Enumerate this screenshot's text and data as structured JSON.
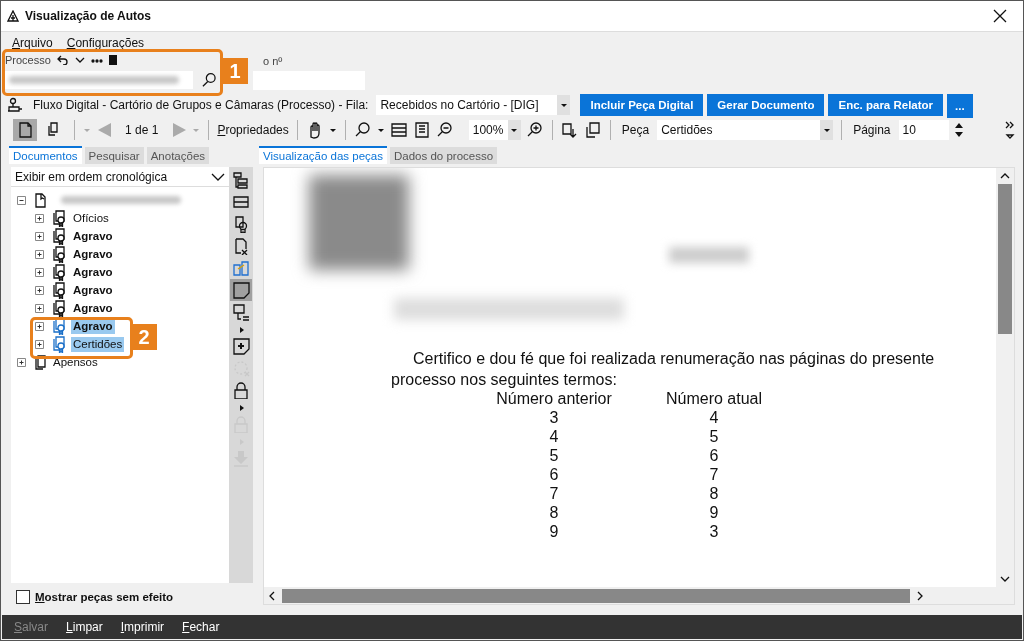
{
  "window": {
    "title": "Visualização de Autos"
  },
  "menu": [
    {
      "label": "Arquivo"
    },
    {
      "label": "Configurações"
    }
  ],
  "process": {
    "label": "Processo",
    "number_label": "o nº"
  },
  "flow": {
    "text": "Fluxo Digital - Cartório de Grupos e Câmaras (Processo) - Fila:",
    "queue": "Recebidos no Cartório - [DIG]",
    "buttons": [
      "Incluir Peça Digital",
      "Gerar Documento",
      "Enc. para Relator",
      "..."
    ]
  },
  "toolbar": {
    "page_indicator": "1 de 1",
    "properties": "Propriedades",
    "zoom": "100%",
    "piece_label": "Peça",
    "piece": "Certidões",
    "page_label": "Página",
    "page": "10"
  },
  "left_tabs": [
    {
      "label": "Documentos",
      "selected": true
    },
    {
      "label": "Pesquisar",
      "selected": false
    },
    {
      "label": "Anotações",
      "selected": false
    }
  ],
  "order_select": "Exibir em ordem cronológica",
  "tree": [
    {
      "kind": "volume",
      "expanded": true,
      "children": [
        {
          "label": "Ofícios",
          "bold": false,
          "selected": false,
          "expanded": false
        },
        {
          "label": "Agravo",
          "bold": true,
          "selected": false,
          "expanded": false
        },
        {
          "label": "Agravo",
          "bold": true,
          "selected": false,
          "expanded": false
        },
        {
          "label": "Agravo",
          "bold": true,
          "selected": false,
          "expanded": false
        },
        {
          "label": "Agravo",
          "bold": true,
          "selected": false,
          "expanded": false
        },
        {
          "label": "Agravo",
          "bold": true,
          "selected": false,
          "expanded": false
        },
        {
          "label": "Agravo",
          "bold": true,
          "selected": true,
          "expanded": false
        },
        {
          "label": "Certidões",
          "bold": false,
          "selected": true,
          "expanded": false
        }
      ]
    },
    {
      "kind": "apensos",
      "label": "Apensos",
      "expanded": false
    }
  ],
  "side_tools": [
    {
      "kind": "tree",
      "pressed": false,
      "disabled": false
    },
    {
      "kind": "split",
      "pressed": false,
      "disabled": false
    },
    {
      "kind": "cert",
      "pressed": false,
      "disabled": false
    },
    {
      "kind": "remove",
      "pressed": false,
      "disabled": false
    },
    {
      "kind": "compare",
      "pressed": false,
      "disabled": false
    },
    {
      "kind": "note",
      "pressed": true,
      "disabled": false
    },
    {
      "kind": "notelist",
      "pressed": false,
      "disabled": false
    },
    {
      "kind": "caret",
      "pressed": false,
      "disabled": false
    },
    {
      "kind": "noteadd",
      "pressed": false,
      "disabled": false
    },
    {
      "kind": "spinner",
      "pressed": false,
      "disabled": true
    },
    {
      "kind": "lock",
      "pressed": false,
      "disabled": false
    },
    {
      "kind": "caret",
      "pressed": false,
      "disabled": false
    },
    {
      "kind": "lock",
      "pressed": false,
      "disabled": true
    },
    {
      "kind": "caret",
      "pressed": false,
      "disabled": true
    },
    {
      "kind": "download",
      "pressed": false,
      "disabled": true
    }
  ],
  "show_void": {
    "label": "Mostrar peças sem efeito",
    "checked": false
  },
  "right_tabs": [
    {
      "label": "Visualização das peças",
      "selected": true
    },
    {
      "label": "Dados do processo",
      "selected": false
    }
  ],
  "document": {
    "paragraph": "Certifico e dou fé que foi realizada renumeração nas páginas do presente processo nos seguintes termos:",
    "columns": [
      "Número anterior",
      "Número atual"
    ],
    "rows": [
      [
        "3",
        "4"
      ],
      [
        "4",
        "5"
      ],
      [
        "5",
        "6"
      ],
      [
        "6",
        "7"
      ],
      [
        "7",
        "8"
      ],
      [
        "8",
        "9"
      ],
      [
        "9",
        "3"
      ]
    ]
  },
  "footer": [
    {
      "label": "Salvar",
      "disabled": true
    },
    {
      "label": "Limpar",
      "disabled": false
    },
    {
      "label": "Imprimir",
      "disabled": false
    },
    {
      "label": "Fechar",
      "disabled": false
    }
  ],
  "callouts": [
    {
      "label": "1"
    },
    {
      "label": "2"
    }
  ]
}
